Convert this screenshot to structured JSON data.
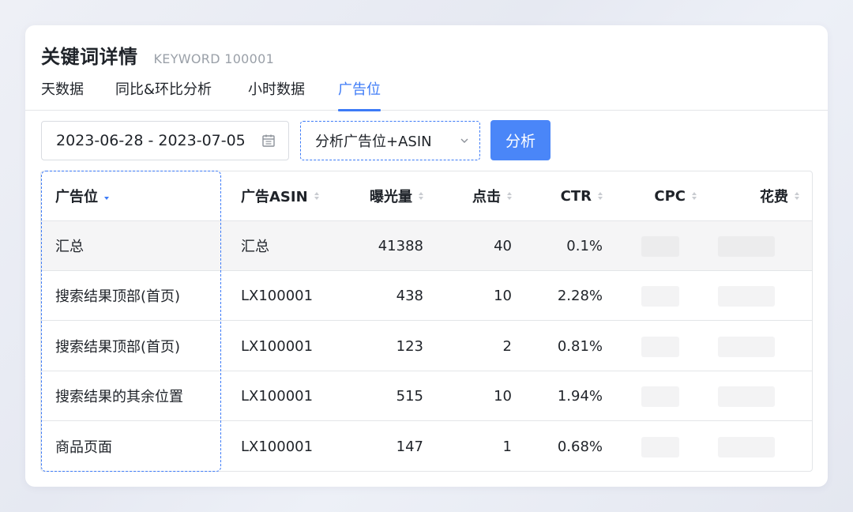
{
  "header": {
    "title": "关键词详情",
    "subtitle": "KEYWORD 100001"
  },
  "tabs": [
    {
      "label": "天数据",
      "active": false
    },
    {
      "label": "同比&环比分析",
      "active": false
    },
    {
      "label": "小时数据",
      "active": false
    },
    {
      "label": "广告位",
      "active": true
    }
  ],
  "filters": {
    "date_range": "2023-06-28 - 2023-07-05",
    "date_icon": "calendar-icon",
    "select_value": "分析广告位+ASIN",
    "select_icon": "chevron-down-icon",
    "analyze_label": "分析"
  },
  "colors": {
    "accent": "#3d7bf7",
    "button": "#4a86f8",
    "summary_row_bg": "#f5f5f6"
  },
  "table": {
    "columns": [
      {
        "label": "广告位",
        "sort": "descending"
      },
      {
        "label": "广告ASIN",
        "sort": "none"
      },
      {
        "label": "曝光量",
        "sort": "none"
      },
      {
        "label": "点击",
        "sort": "none"
      },
      {
        "label": "CTR",
        "sort": "none"
      },
      {
        "label": "CPC",
        "sort": "none"
      },
      {
        "label": "花费",
        "sort": "none"
      }
    ],
    "rows": [
      {
        "placement": "汇总",
        "asin": "汇总",
        "impressions": "41388",
        "clicks": "40",
        "ctr": "0.1%"
      },
      {
        "placement": "搜索结果顶部(首页)",
        "asin": "LX100001",
        "impressions": "438",
        "clicks": "10",
        "ctr": "2.28%"
      },
      {
        "placement": "搜索结果顶部(首页)",
        "asin": "LX100001",
        "impressions": "123",
        "clicks": "2",
        "ctr": "0.81%"
      },
      {
        "placement": "搜索结果的其余位置",
        "asin": "LX100001",
        "impressions": "515",
        "clicks": "10",
        "ctr": "1.94%"
      },
      {
        "placement": "商品页面",
        "asin": "LX100001",
        "impressions": "147",
        "clicks": "1",
        "ctr": "0.68%"
      }
    ]
  }
}
